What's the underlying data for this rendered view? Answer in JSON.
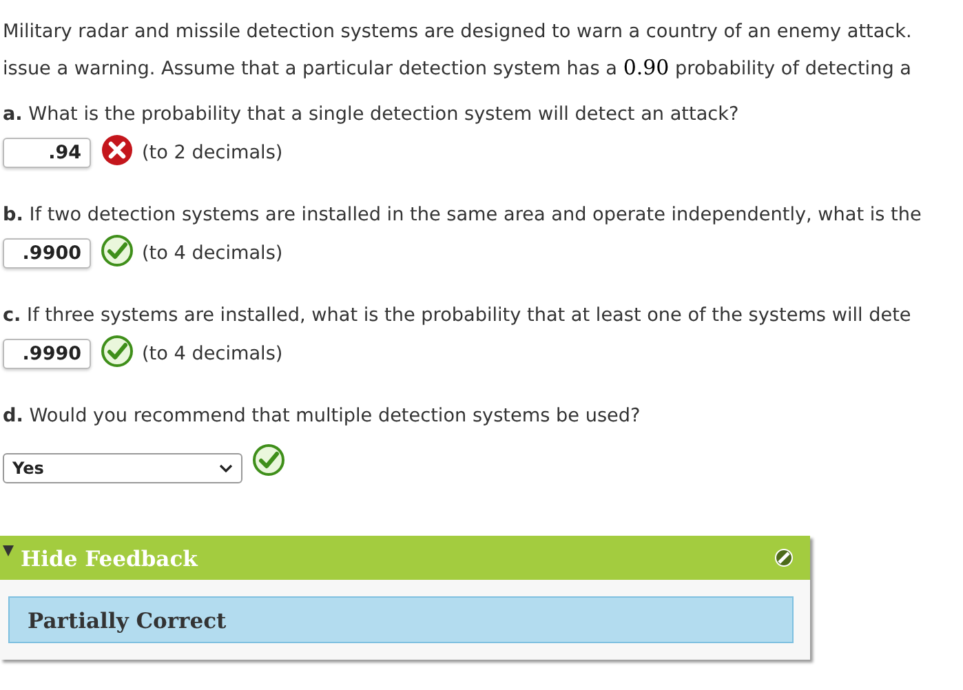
{
  "intro": {
    "line_1": "Military radar and missile detection systems are designed to warn a country of an enemy attack.",
    "line_2_before": "issue a warning. Assume that a particular detection system has a",
    "line_2_math": "0.90",
    "line_2_after": "probability of detecting a"
  },
  "questions": [
    {
      "letter": "a.",
      "text": "What is the probability that a single detection system will detect an attack?",
      "answer": {
        "kind": "input",
        "value": ".94",
        "correct": false,
        "note": "(to 2 decimals)"
      }
    },
    {
      "letter": "b.",
      "text": "If two detection systems are installed in the same area and operate independently, what is the",
      "answer": {
        "kind": "input",
        "value": ".9900",
        "correct": true,
        "note": "(to 4 decimals)"
      }
    },
    {
      "letter": "c.",
      "text": "If three systems are installed, what is the probability that at least one of the systems will dete",
      "answer": {
        "kind": "input",
        "value": ".9990",
        "correct": true,
        "note": "(to 4 decimals)"
      }
    },
    {
      "letter": "d.",
      "text": "Would you recommend that multiple detection systems be used?",
      "answer": {
        "kind": "select",
        "value": "Yes",
        "correct": true
      }
    }
  ],
  "feedback": {
    "expanded": true,
    "toggle_label": "Hide Feedback",
    "result": "Partially Correct"
  }
}
